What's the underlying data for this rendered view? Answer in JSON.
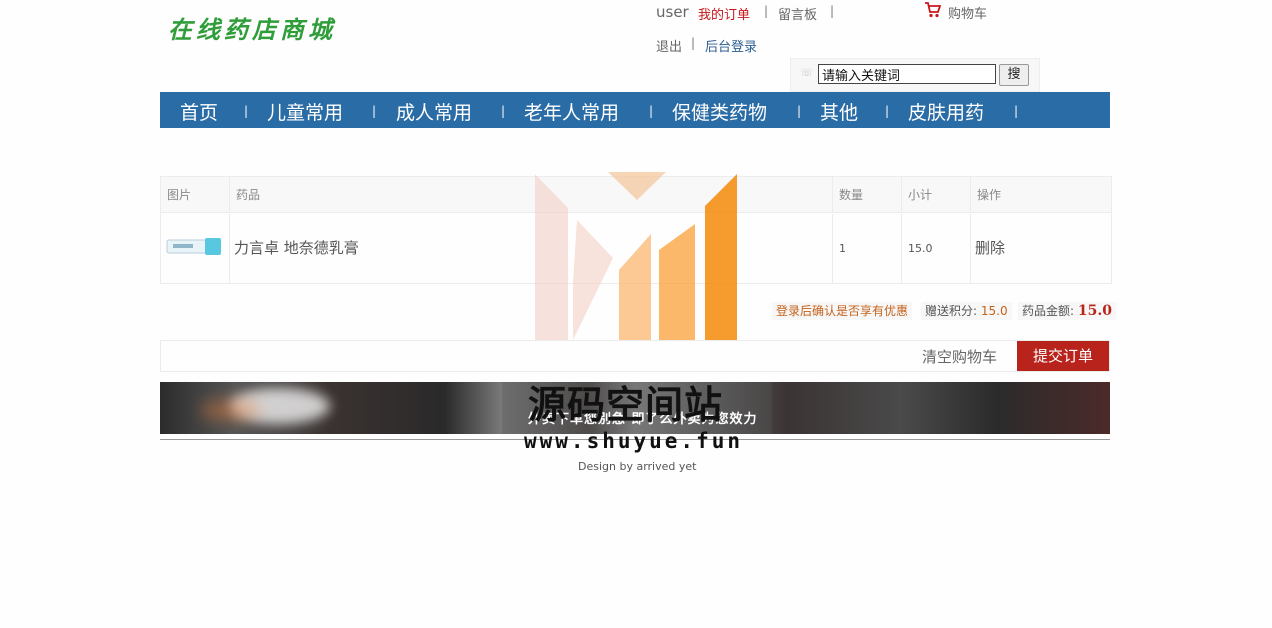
{
  "site": {
    "logo_text": "在线药店商城"
  },
  "header": {
    "username": "user",
    "my_orders": "我的订单",
    "message_board": "留言板",
    "logout": "退出",
    "admin_login": "后台登录",
    "cart": "购物车",
    "separator": "|"
  },
  "search": {
    "value": "请输入关键词",
    "button": "搜"
  },
  "nav": {
    "items": [
      "首页",
      "儿童常用",
      "成人常用",
      "老年人常用",
      "保健类药物",
      "其他",
      "皮肤用药"
    ],
    "separator": "|"
  },
  "cart_table": {
    "headers": {
      "image": "图片",
      "product": "药品",
      "quantity": "数量",
      "subtotal": "小计",
      "action": "操作"
    },
    "rows": [
      {
        "product": "力言卓 地奈德乳膏",
        "quantity": "1",
        "subtotal": "15.0",
        "action": "删除"
      }
    ]
  },
  "summary": {
    "login_notice": "登录后确认是否享有优惠",
    "points_label": "赠送积分:",
    "points_value": "15.0",
    "total_label": "药品金额:",
    "total_value": "15.0"
  },
  "actions": {
    "clear_cart": "清空购物车",
    "submit_order": "提交订单"
  },
  "banner": {
    "text": "外卖下单您别急 即了么外卖为您效力"
  },
  "footer": {
    "credit": "Design by arrived yet"
  },
  "watermark": {
    "title": "源码空间站",
    "url": "www.shuyue.fun"
  },
  "colors": {
    "nav_bg": "#2a6ca6",
    "logo": "#2f9e3a",
    "accent_red": "#c8171d",
    "submit_bg": "#b8241c",
    "notice_orange": "#c5621a"
  }
}
